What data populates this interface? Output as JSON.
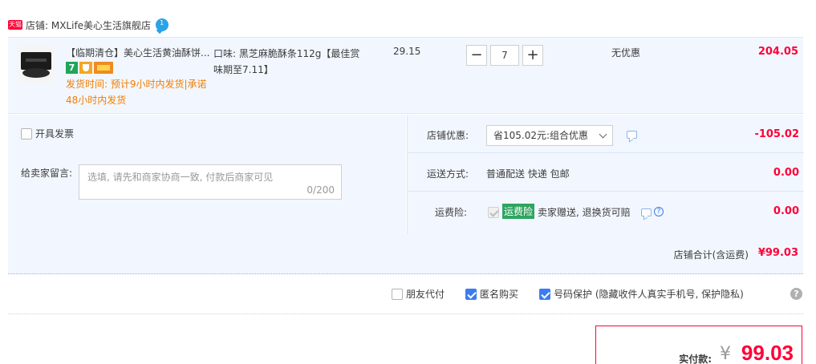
{
  "shop": {
    "badge": "天猫",
    "name": "店铺: MXLife美心生活旗舰店",
    "ww_badge": "1"
  },
  "item": {
    "title": "【临期清仓】美心生活黄油酥饼...",
    "shipping_time": "发货时间: 预计9小时内发货|承诺48小时内发货",
    "spec": "口味: 黑芝麻脆酥条112g【最佳赏味期至7.11】",
    "unit_price": "29.15",
    "quantity": "7",
    "qty_minus": "−",
    "qty_plus": "+",
    "discount_text": "无优惠",
    "subtotal": "204.05"
  },
  "invoice": {
    "label": "开具发票",
    "checked": false
  },
  "message": {
    "label": "给卖家留言:",
    "placeholder": "选填, 请先和商家协商一致, 付款后商家可见",
    "counter": "0/200"
  },
  "shop_discount": {
    "label": "店铺优惠:",
    "selected": "省105.02元:组合优惠",
    "amount": "-105.02"
  },
  "delivery": {
    "label": "运送方式:",
    "value": "普通配送 快递 包邮",
    "amount": "0.00"
  },
  "insurance": {
    "label": "运费险:",
    "badge": "运费险",
    "text": "卖家赠送, 退换货可赔",
    "help": "?",
    "amount": "0.00"
  },
  "shop_total": {
    "label": "店铺合计(含运费)",
    "amount": "¥99.03"
  },
  "extras": {
    "friend_pay": {
      "label": "朋友代付",
      "checked": false
    },
    "anonymous": {
      "label": "匿名购买",
      "checked": true
    },
    "phone_protect": {
      "label": "号码保护 (隐藏收件人真实手机号, 保护隐私)",
      "checked": true
    },
    "help": "?"
  },
  "payment": {
    "label": "实付款:",
    "currency": "¥",
    "amount": "99.03"
  },
  "colors": {
    "accent_red": "#ff0036",
    "panel_blue": "#f2f7ff",
    "check_blue": "#3c7cf0",
    "ship_orange": "#f57c00",
    "insurance_green": "#2ea55f"
  }
}
